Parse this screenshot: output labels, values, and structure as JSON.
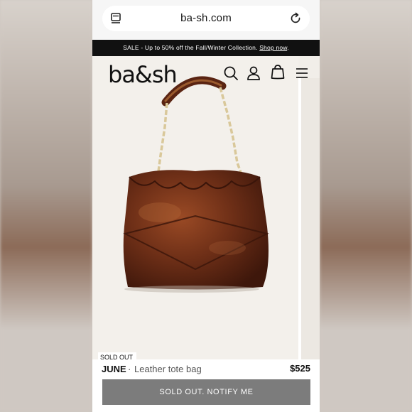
{
  "browser": {
    "url": "ba-sh.com",
    "tabs_icon": "tabs-icon",
    "reload_icon": "reload-icon"
  },
  "promo": {
    "text": "SALE - Up to 50% off the Fall/Winter Collection. ",
    "link": "Shop now",
    "tail": "."
  },
  "header": {
    "logo": "ba&sh",
    "icons": [
      "search-icon",
      "account-icon",
      "bag-icon",
      "menu-icon"
    ]
  },
  "product": {
    "badge": "SOLD OUT",
    "name": "JUNE",
    "separator": "·",
    "type": "Leather tote bag",
    "price": "$525",
    "cta": "SOLD OUT. NOTIFY ME"
  },
  "colors": {
    "promo_bg": "#111111",
    "bag_leather": "#6b2f1a",
    "chain_gold": "#d9c89a",
    "button_bg": "#7c7c7c"
  }
}
